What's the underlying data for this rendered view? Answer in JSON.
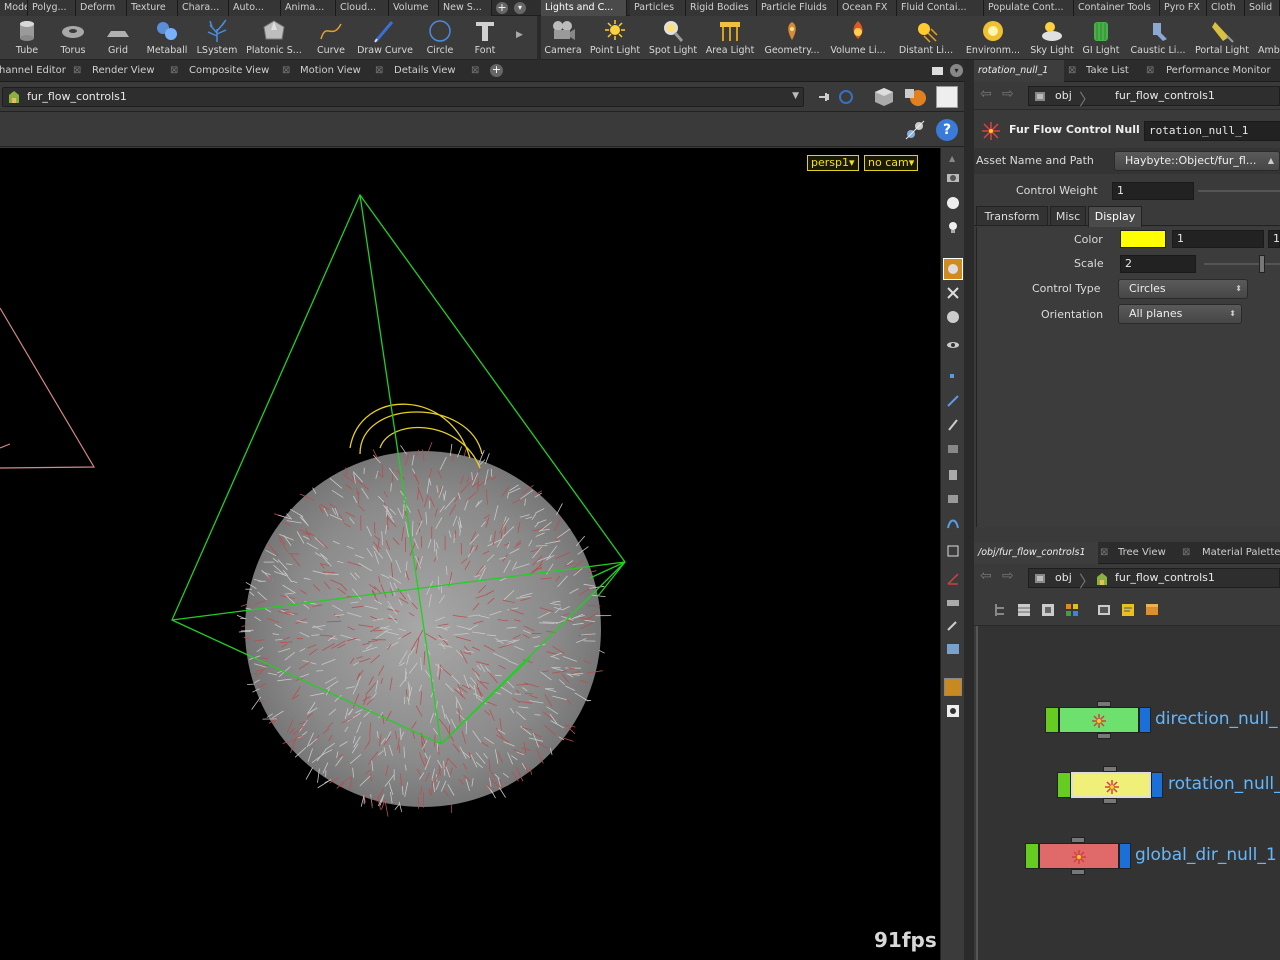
{
  "shelf_tabs_left": [
    "Model",
    "Polyg...",
    "Deform",
    "Texture",
    "Chara...",
    "Auto...",
    "Anima...",
    "Cloud...",
    "Volume",
    "New S..."
  ],
  "shelf_tabs_right": [
    "Lights and C...",
    "Particles",
    "Rigid Bodies",
    "Particle Fluids",
    "Ocean FX",
    "Fluid Contai...",
    "Populate Cont...",
    "Container Tools",
    "Pyro FX",
    "Cloth",
    "Solid"
  ],
  "tools_left": [
    "Tube",
    "Torus",
    "Grid",
    "Metaball",
    "LSystem",
    "Platonic S...",
    "Curve",
    "Draw Curve",
    "Circle",
    "Font"
  ],
  "tools_right": [
    "Camera",
    "Point Light",
    "Spot Light",
    "Area Light",
    "Geometry...",
    "Volume Li...",
    "Distant Li...",
    "Environm...",
    "Sky Light",
    "GI Light",
    "Caustic Li...",
    "Portal Light",
    "Amb"
  ],
  "left_pane_tabs": [
    "Channel Editor",
    "Render View",
    "Composite View",
    "Motion View",
    "Details View"
  ],
  "viewport": {
    "path": "fur_flow_controls1",
    "cam_persp": "persp1▾",
    "cam_none": "no cam▾",
    "fps": "91fps"
  },
  "right_top_tabs": [
    "rotation_null_1",
    "Take List",
    "Performance Monitor"
  ],
  "params": {
    "path_root": "obj",
    "path_node": "fur_flow_controls1",
    "node_type": "Fur Flow Control Null",
    "node_name": "rotation_null_1",
    "asset_label": "Asset Name and Path",
    "asset_value": "Haybyte::Object/fur_fl...",
    "weight_label": "Control Weight",
    "weight_value": "1",
    "subtabs": [
      "Transform",
      "Misc",
      "Display"
    ],
    "color_label": "Color",
    "color_r": "1",
    "color_g": "1",
    "color_swatch": "#ffff00",
    "scale_label": "Scale",
    "scale_value": "2",
    "scale_slider_frac": 0.78,
    "control_type_label": "Control Type",
    "control_type_value": "Circles",
    "orientation_label": "Orientation",
    "orientation_value": "All planes"
  },
  "right_bottom_tabs": [
    "/obj/fur_flow_controls1",
    "Tree View",
    "Material Palette"
  ],
  "network": {
    "path_root": "obj",
    "path_node": "fur_flow_controls1",
    "nodes": [
      {
        "label": "direction_null_",
        "color": "#6ee06e"
      },
      {
        "label": "rotation_null_",
        "color": "#f0f078"
      },
      {
        "label": "global_dir_null_1",
        "color": "#e06a6a"
      }
    ]
  }
}
